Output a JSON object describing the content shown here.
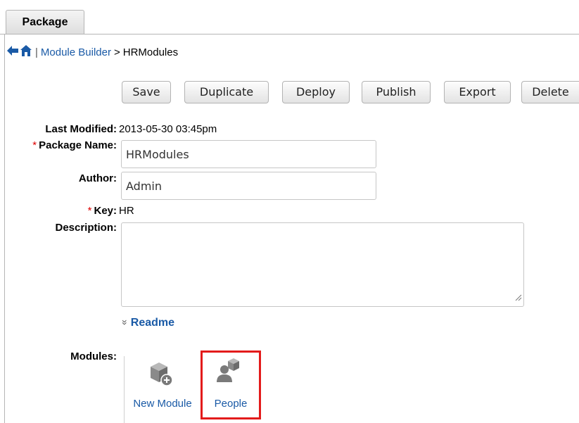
{
  "tab": {
    "label": "Package"
  },
  "nav": {
    "separator": "|",
    "module_builder": "Module Builder",
    "crumb_arrow": ">",
    "current": "HRModules"
  },
  "toolbar": {
    "save": "Save",
    "duplicate": "Duplicate",
    "deploy": "Deploy",
    "publish": "Publish",
    "export": "Export",
    "delete": "Delete"
  },
  "form": {
    "last_modified_label": "Last Modified:",
    "last_modified_value": "2013-05-30 03:45pm",
    "package_name_label": "Package Name:",
    "package_name_value": "HRModules",
    "author_label": "Author:",
    "author_value": "Admin",
    "key_label": "Key:",
    "key_value": "HR",
    "description_label": "Description:",
    "description_value": "",
    "required_mark": "*"
  },
  "readme": {
    "chevron": "»",
    "label": "Readme"
  },
  "modules": {
    "label": "Modules:",
    "items": [
      {
        "label": "New Module",
        "icon": "new-module-icon"
      },
      {
        "label": "People",
        "icon": "people-module-icon"
      }
    ]
  },
  "colors": {
    "link": "#1a5aa6",
    "required": "#dd0000",
    "highlight": "#e31b1b"
  }
}
